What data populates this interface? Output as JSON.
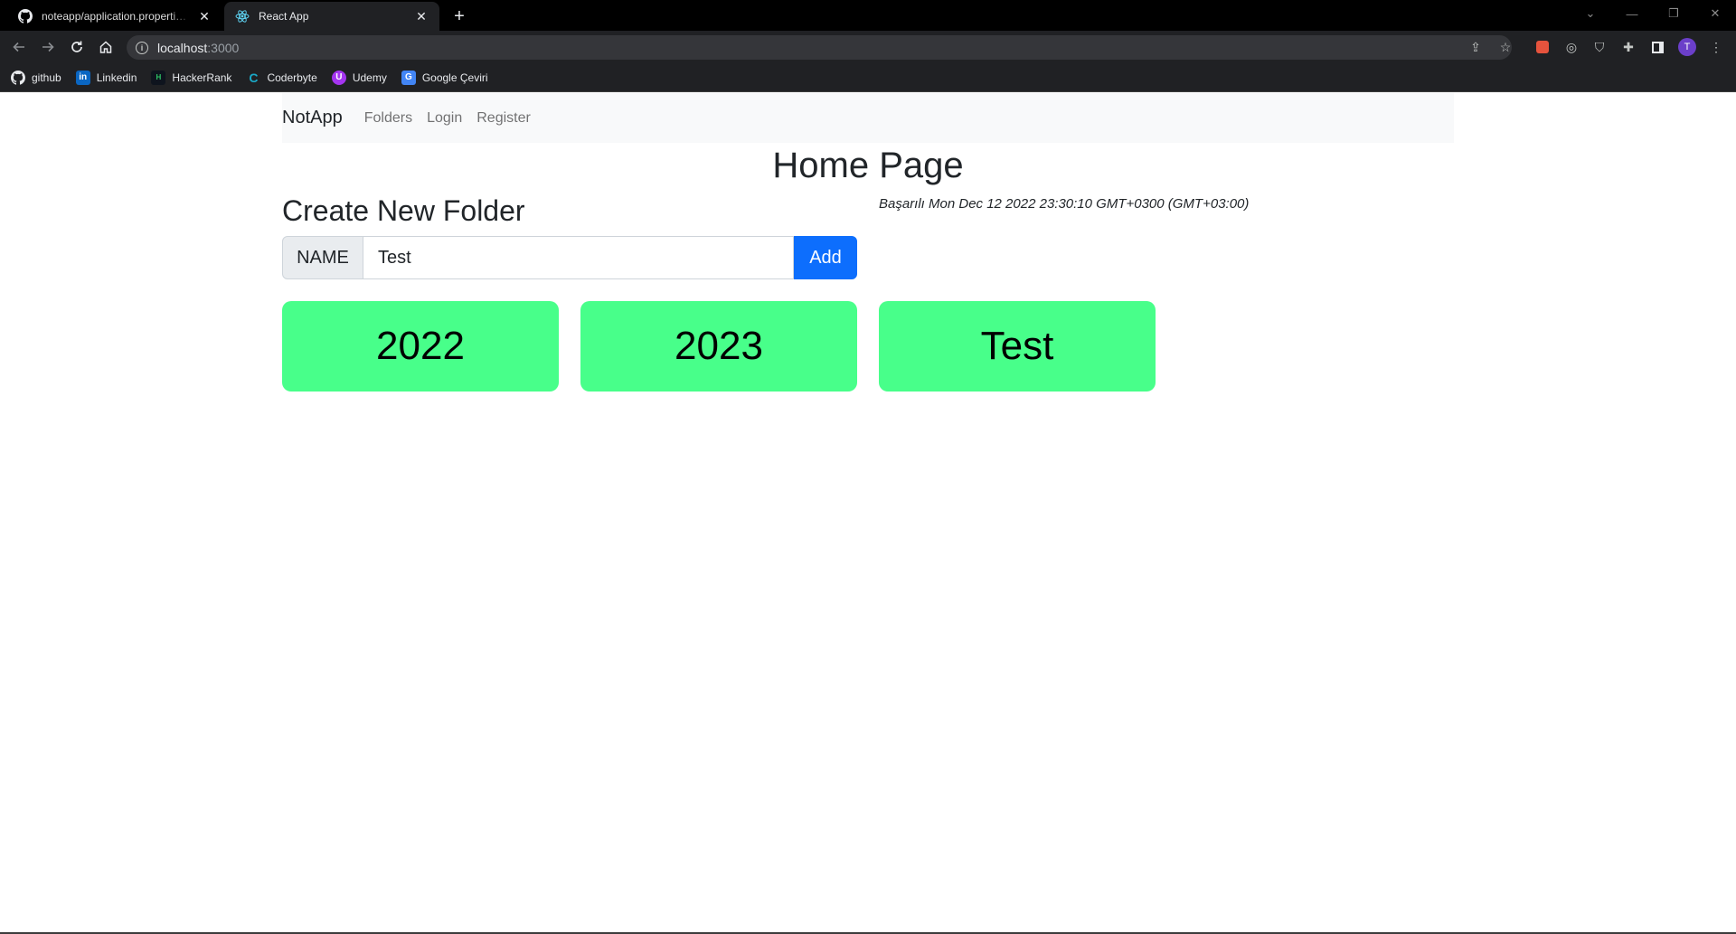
{
  "browser": {
    "tabs": [
      {
        "title": "noteapp/application.properties at",
        "icon": "github-icon"
      },
      {
        "title": "React App",
        "icon": "react-icon"
      }
    ],
    "address": {
      "host": "localhost",
      "port": ":3000"
    },
    "bookmarks": [
      {
        "label": "github",
        "icon": "github-icon",
        "color": "#ffffff"
      },
      {
        "label": "Linkedin",
        "icon": "linkedin-icon",
        "color": "#0a66c2"
      },
      {
        "label": "HackerRank",
        "icon": "hackerrank-icon",
        "color": "#0e141e"
      },
      {
        "label": "Coderbyte",
        "icon": "coderbyte-icon",
        "color": "#1aa9c8"
      },
      {
        "label": "Udemy",
        "icon": "udemy-icon",
        "color": "#a435f0"
      },
      {
        "label": "Google Çeviri",
        "icon": "google-translate-icon",
        "color": "#4285f4"
      }
    ],
    "profile_initial": "T"
  },
  "navbar": {
    "brand": "NotApp",
    "links": [
      "Folders",
      "Login",
      "Register"
    ]
  },
  "main": {
    "title": "Home Page",
    "create_title": "Create New Folder",
    "status": "Başarılı Mon Dec 12 2022 23:30:10 GMT+0300 (GMT+03:00)",
    "form": {
      "label": "NAME",
      "value": "Test",
      "button": "Add"
    },
    "folders": [
      "2022",
      "2023",
      "Test"
    ]
  },
  "colors": {
    "accent": "#0d6efd",
    "folder_card": "#48ff8a"
  }
}
